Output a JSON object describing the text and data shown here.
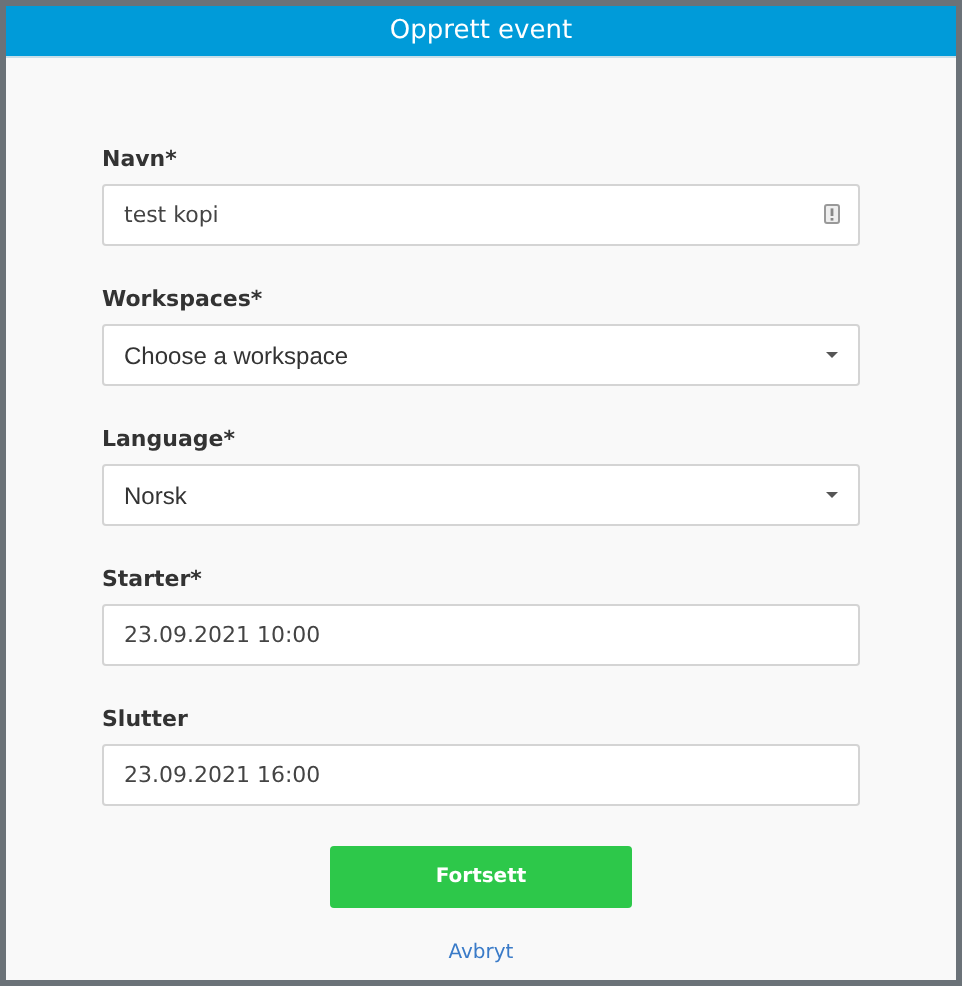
{
  "window": {
    "title": "Opprett event"
  },
  "fields": [
    {
      "kind": "text",
      "label": "Navn*",
      "value": "test kopi",
      "icon": true
    },
    {
      "kind": "select",
      "label": "Workspaces*",
      "value": "Choose a workspace"
    },
    {
      "kind": "select",
      "label": "Language*",
      "value": "Norsk"
    },
    {
      "kind": "text",
      "label": "Starter*",
      "value": "23.09.2021 10:00"
    },
    {
      "kind": "text",
      "label": "Slutter",
      "value": "23.09.2021 16:00"
    }
  ],
  "primary_button": "Fortsett",
  "cancel_link": "Avbryt"
}
